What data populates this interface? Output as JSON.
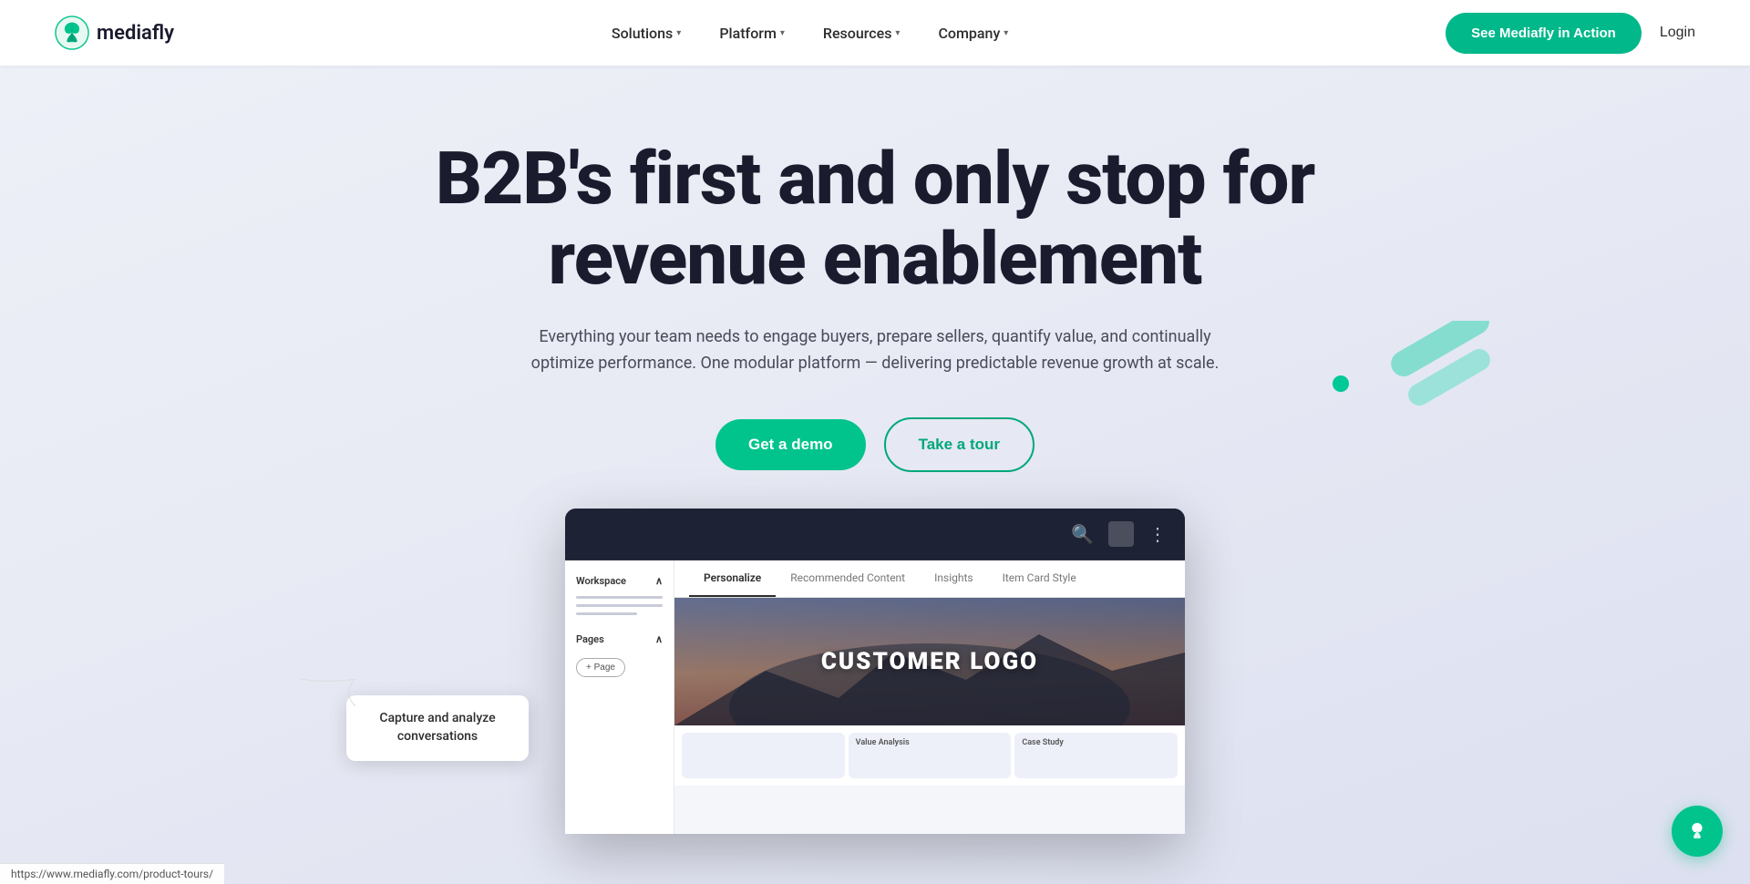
{
  "nav": {
    "logo_text": "mediafly",
    "links": [
      {
        "label": "Solutions",
        "has_chevron": true
      },
      {
        "label": "Platform",
        "has_chevron": true
      },
      {
        "label": "Resources",
        "has_chevron": true
      },
      {
        "label": "Company",
        "has_chevron": true
      }
    ],
    "cta_button": "See Mediafly in Action",
    "login_label": "Login"
  },
  "hero": {
    "title": "B2B's first and only stop for revenue enablement",
    "subtitle": "Everything your team needs to engage buyers, prepare sellers, quantify value, and continually optimize performance. One modular platform — delivering predictable revenue growth at scale.",
    "demo_button": "Get a demo",
    "tour_button": "Take a tour"
  },
  "product_preview": {
    "sidebar": {
      "workspace_label": "Workspace",
      "pages_label": "Pages",
      "add_page_button": "+ Page"
    },
    "tabs": [
      {
        "label": "Personalize",
        "active": true
      },
      {
        "label": "Recommended Content",
        "active": false
      },
      {
        "label": "Insights",
        "active": false
      },
      {
        "label": "Item Card Style",
        "active": false
      }
    ],
    "customer_logo": "CUSTOMER LOGO",
    "bottom_cards": [
      {
        "label": ""
      },
      {
        "label": "Value Analysis"
      },
      {
        "label": "Case Study"
      }
    ]
  },
  "tooltip": {
    "text": "Capture and analyze conversations"
  },
  "url_bar": {
    "text": "https://www.mediafly.com/product-tours/"
  },
  "fab": {
    "icon": "🌿"
  }
}
